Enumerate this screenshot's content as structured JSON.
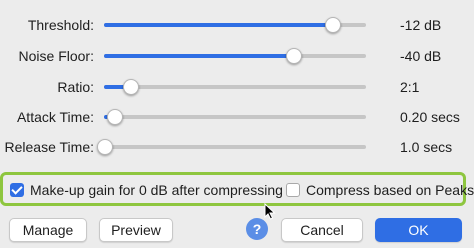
{
  "sliders": [
    {
      "label": "Threshold",
      "value": "-12 dB",
      "position": 0.87
    },
    {
      "label": "Noise Floor",
      "value": "-40 dB",
      "position": 0.72
    },
    {
      "label": "Ratio",
      "value": "2:1",
      "position": 0.1
    },
    {
      "label": "Attack Time",
      "value": "0.20 secs",
      "position": 0.04
    },
    {
      "label": "Release Time",
      "value": "1.0 secs",
      "position": 0.0
    }
  ],
  "options": {
    "makeup_gain": {
      "label": "Make-up gain for 0 dB after compressing",
      "checked": true
    },
    "compress_peaks": {
      "label": "Compress based on Peaks",
      "checked": false
    }
  },
  "buttons": {
    "manage": "Manage",
    "preview": "Preview",
    "help": "?",
    "cancel": "Cancel",
    "ok": "OK"
  },
  "colors": {
    "accent": "#2f6ee4",
    "highlight_border": "#8ec63f",
    "track": "#c6c6c6"
  }
}
